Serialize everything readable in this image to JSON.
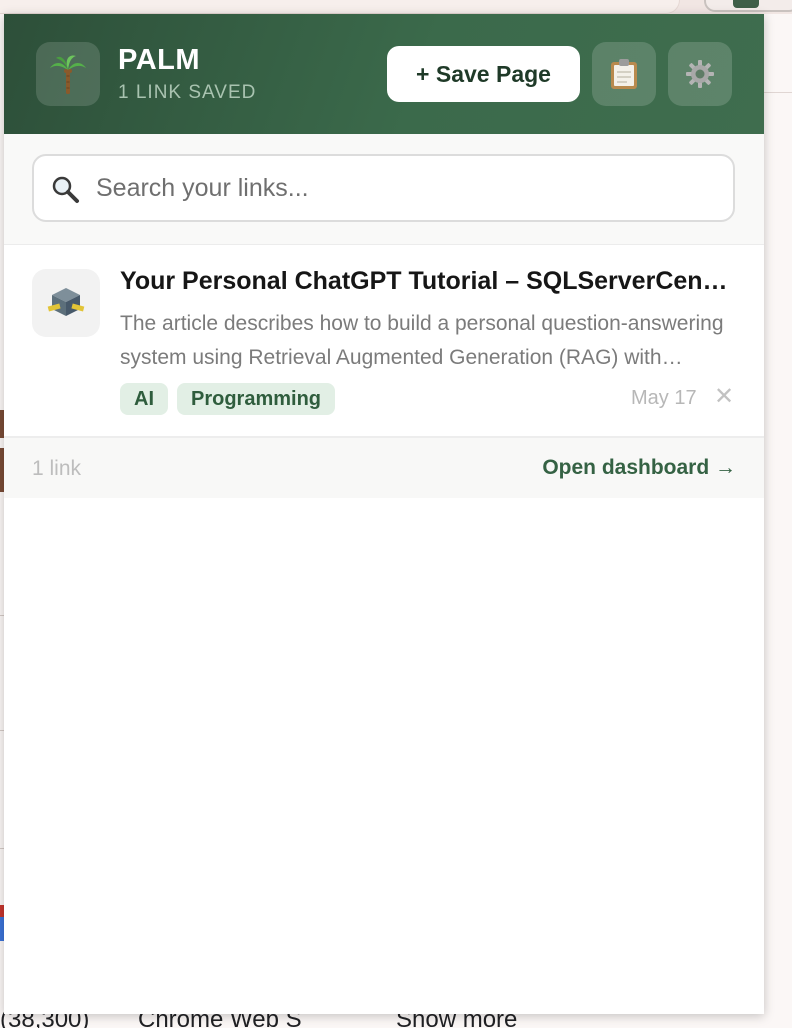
{
  "app": {
    "name": "PALM",
    "saved_count": "1 LINK SAVED",
    "logo_icon": "palm-tree-icon"
  },
  "header": {
    "save_label": "+ Save Page",
    "clipboard_icon": "clipboard-icon",
    "settings_icon": "gear-icon"
  },
  "search": {
    "placeholder": "Search your links...",
    "value": "",
    "icon": "magnifier-icon"
  },
  "links": [
    {
      "title": "Your Personal ChatGPT Tutorial – SQLServerCentral",
      "description": "The article describes how to build a personal question-answering system using Retrieval Augmented Generation (RAG) with ChatGPT.",
      "tags": [
        "AI",
        "Programming"
      ],
      "date": "May 17",
      "favicon": "site-logo-icon",
      "delete_symbol": "✕"
    }
  ],
  "footer": {
    "count": "1 link",
    "dashboard_label": "Open dashboard →"
  },
  "background_page": {
    "text_1": "(38,300)",
    "text_2": "Chrome Web S",
    "text_3": "Show more"
  },
  "colors": {
    "header_start": "#2d4f39",
    "header_end": "#3f6d4e",
    "accent": "#356244",
    "tag_bg": "#e2efe5",
    "tag_text": "#2f5d3d"
  }
}
